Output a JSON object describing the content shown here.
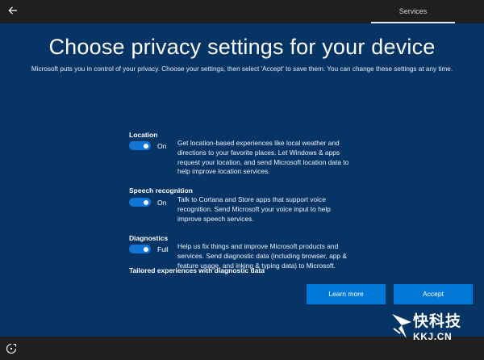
{
  "topbar": {
    "tab_label": "Services"
  },
  "page": {
    "title": "Choose privacy settings for your device",
    "subtitle": "Microsoft puts you in control of your privacy. Choose your settings, then select 'Accept' to save them. You can change these settings at any time."
  },
  "settings": [
    {
      "label": "Location",
      "state": "On",
      "description": "Get location-based experiences like local weather and directions to your favorite places. Let Windows & apps request your location, and send Microsoft location data to help improve location services."
    },
    {
      "label": "Speech recognition",
      "state": "On",
      "description": "Talk to Cortana and Store apps that support voice recognition. Send Microsoft your voice input to help improve speech services."
    },
    {
      "label": "Diagnostics",
      "state": "Full",
      "description": "Help us fix things and improve Microsoft products and services. Send diagnostic data (including browser, app & feature usage, and inking & typing data) to Microsoft."
    }
  ],
  "tailored_label": "Tailored experiences with diagnostic data",
  "buttons": {
    "learn_more": "Learn more",
    "accept": "Accept"
  },
  "watermark": {
    "cn": "快科技",
    "en": "KKJ.CN"
  },
  "colors": {
    "background": "#063465",
    "accent": "#0078d7",
    "toggle": "#0f78d4",
    "bar": "#1f1f1f"
  }
}
